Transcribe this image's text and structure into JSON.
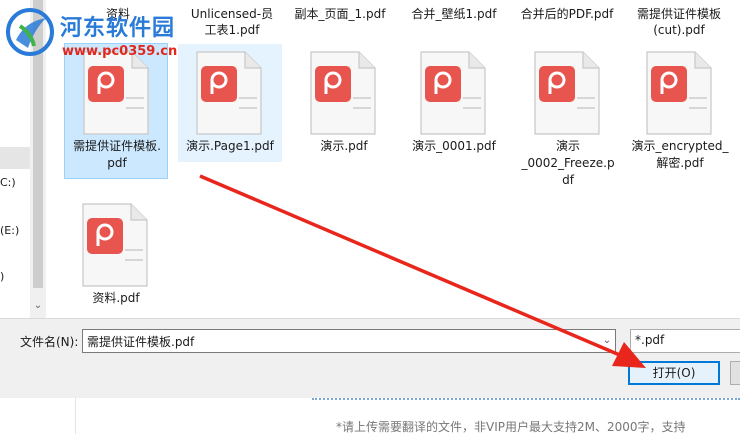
{
  "nav": {
    "items": [
      {
        "label": "C:)"
      },
      {
        "label": "(E:)"
      },
      {
        "label": ")"
      }
    ]
  },
  "top_row_files": [
    {
      "name": "资料"
    },
    {
      "name": "Unlicensed-员\n工表1.pdf"
    },
    {
      "name": "副本_页面_1.pdf"
    },
    {
      "name": "合并_壁纸1.pdf"
    },
    {
      "name": "合并后的PDF.pdf"
    },
    {
      "name": "需提供证件模板\n(cut).pdf"
    }
  ],
  "files": [
    {
      "name": "需提供证件模板.\npdf",
      "state": "selected"
    },
    {
      "name": "演示.Page1.pdf",
      "state": "hover"
    },
    {
      "name": "演示.pdf",
      "state": "normal"
    },
    {
      "name": "演示_0001.pdf",
      "state": "normal"
    },
    {
      "name": "演示\n_0002_Freeze.p\ndf",
      "state": "normal"
    },
    {
      "name": "演示_encrypted_\n解密.pdf",
      "state": "normal"
    },
    {
      "name": "资料.pdf",
      "state": "normal"
    }
  ],
  "bottom": {
    "filename_label": "文件名(N):",
    "filename_value": "需提供证件模板.pdf",
    "filetype_value": "*.pdf",
    "open_label": "打开(O)"
  },
  "behind": {
    "note": "*请上传需要翻译的文件，非VIP用户最大支持2M、2000字，支持"
  },
  "watermark": {
    "title": "河东软件园",
    "url": "www.pc0359.cn"
  },
  "colors": {
    "pdf_icon": "#e8544e",
    "selection": "#cce8ff",
    "accent": "#0078d7",
    "arrow": "#e8261c"
  }
}
